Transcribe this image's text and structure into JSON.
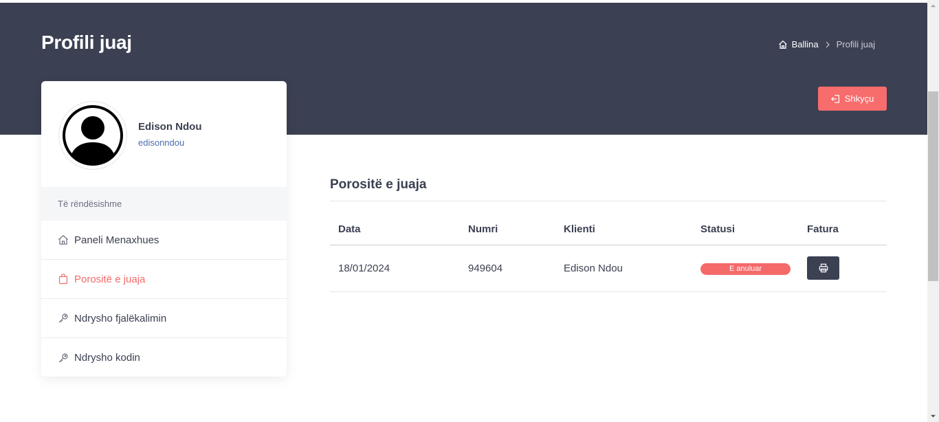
{
  "header": {
    "title": "Profili juaj",
    "breadcrumb": {
      "home": "Ballina",
      "current": "Profili juaj"
    },
    "logout_label": "Shkyçu"
  },
  "profile": {
    "name": "Edison Ndou",
    "username": "edisonndou"
  },
  "sidebar": {
    "section_label": "Të rëndësishme",
    "items": [
      {
        "label": "Paneli Menaxhues",
        "icon": "home-icon"
      },
      {
        "label": "Porositë e juaja",
        "icon": "shopping-bag-icon",
        "active": true
      },
      {
        "label": "Ndrysho fjalëkalimin",
        "icon": "key-icon"
      },
      {
        "label": "Ndrysho kodin",
        "icon": "key-icon"
      }
    ]
  },
  "orders": {
    "title": "Porositë e juaja",
    "columns": [
      "Data",
      "Numri",
      "Klienti",
      "Statusi",
      "Fatura"
    ],
    "rows": [
      {
        "date": "18/01/2024",
        "number": "949604",
        "client": "Edison Ndou",
        "status": "E anuluar"
      }
    ]
  },
  "colors": {
    "header_bg": "#3b4052",
    "accent_red": "#f46a6a",
    "link_blue": "#4a6ea9"
  }
}
